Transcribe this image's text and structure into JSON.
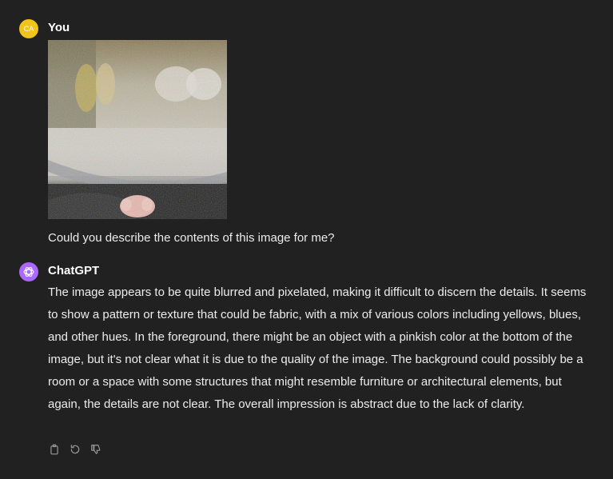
{
  "user_message": {
    "avatar_initials": "CA",
    "author": "You",
    "text": "Could you describe the contents of this image for me?"
  },
  "assistant_message": {
    "author": "ChatGPT",
    "text": "The image appears to be quite blurred and pixelated, making it difficult to discern the details. It seems to show a pattern or texture that could be fabric, with a mix of various colors including yellows, blues, and other hues. In the foreground, there might be an object with a pinkish color at the bottom of the image, but it's not clear what it is due to the quality of the image. The background could possibly be a room or a space with some structures that might resemble furniture or architectural elements, but again, the details are not clear. The overall impression is abstract due to the lack of clarity."
  },
  "actions": {
    "icons": [
      "copy-icon",
      "regenerate-icon",
      "thumbs-down-icon"
    ]
  },
  "colors": {
    "background": "#212121",
    "text": "#ececec",
    "user_avatar": "#f2c31a",
    "assistant_avatar": "#ab68ff"
  }
}
